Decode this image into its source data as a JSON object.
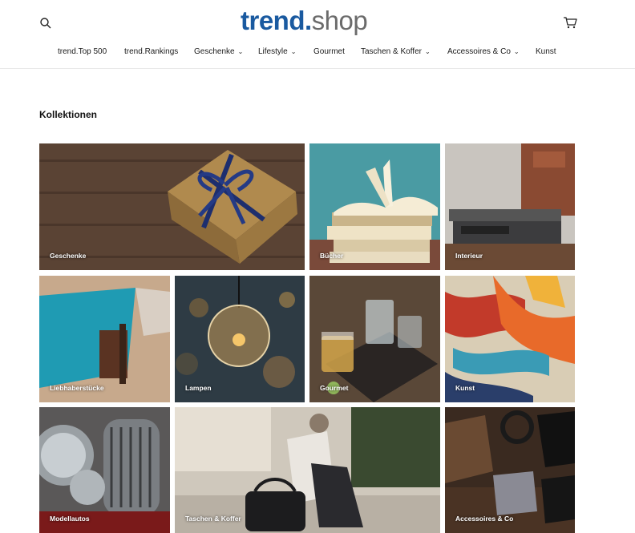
{
  "header": {
    "logo": {
      "bold": "trend.",
      "thin": "shop"
    },
    "search_icon": "search-icon",
    "cart_icon": "cart-icon"
  },
  "nav": {
    "items": [
      {
        "label": "trend.Top 500",
        "has_dropdown": false
      },
      {
        "label": "trend.Rankings",
        "has_dropdown": false
      },
      {
        "label": "Geschenke",
        "has_dropdown": true
      },
      {
        "label": "Lifestyle",
        "has_dropdown": true
      },
      {
        "label": "Gourmet",
        "has_dropdown": false
      },
      {
        "label": "Taschen & Koffer",
        "has_dropdown": true
      },
      {
        "label": "Accessoires & Co",
        "has_dropdown": true
      },
      {
        "label": "Kunst",
        "has_dropdown": false
      }
    ],
    "chevron": "⌄"
  },
  "main": {
    "title": "Kollektionen",
    "collections": [
      {
        "label": "Geschenke"
      },
      {
        "label": "Bücher"
      },
      {
        "label": "Interieur"
      },
      {
        "label": "Liebhaberstücke"
      },
      {
        "label": "Lampen"
      },
      {
        "label": "Gourmet"
      },
      {
        "label": "Kunst"
      },
      {
        "label": "Modellautos"
      },
      {
        "label": "Taschen & Koffer"
      },
      {
        "label": "Accessoires & Co"
      }
    ]
  },
  "colors": {
    "brand": "#1a5aa0",
    "logo_gray": "#6b6b6b"
  }
}
